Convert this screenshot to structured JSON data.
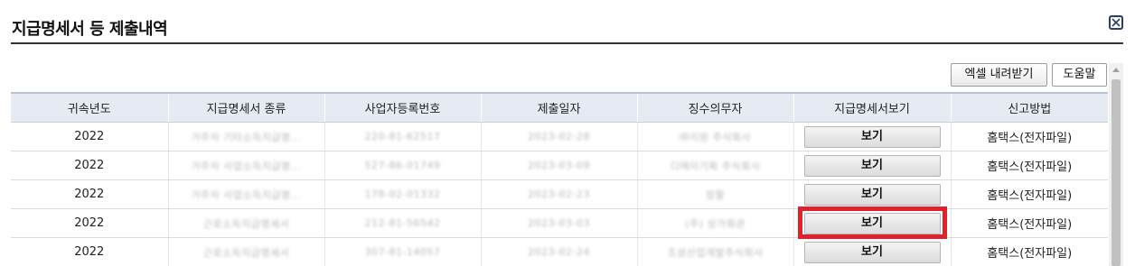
{
  "window": {
    "title": "지급명세서 등 제출내역",
    "close_icon": "close-icon"
  },
  "toolbar": {
    "excel_label": "엑셀 내려받기",
    "help_label": "도움말"
  },
  "table": {
    "columns": [
      "귀속년도",
      "지급명세서 종류",
      "사업자등록번호",
      "제출일자",
      "징수의무자",
      "지급명세서보기",
      "신고방법"
    ],
    "rows": [
      {
        "year": "2022",
        "type": "거주자 기타소득지급명...",
        "bizno": "220-81-62517",
        "date": "2023-02-28",
        "withholder": "㈜지원 주식회사",
        "view_label": "보기",
        "method": "홈택스(전자파일)"
      },
      {
        "year": "2022",
        "type": "거주자 사업소득지급명...",
        "bizno": "527-86-01749",
        "date": "2023-03-09",
        "withholder": "디에이기획 주식회사",
        "view_label": "보기",
        "method": "홈택스(전자파일)"
      },
      {
        "year": "2022",
        "type": "거주자 사업소득지급명...",
        "bizno": "178-02-01332",
        "date": "2023-02-23",
        "withholder": "정활",
        "view_label": "보기",
        "method": "홈택스(전자파일)"
      },
      {
        "year": "2022",
        "type": "근로소득지급명세서",
        "bizno": "212-81-56542",
        "date": "2023-03-03",
        "withholder": "(주) 상가회관",
        "view_label": "보기",
        "method": "홈택스(전자파일)"
      },
      {
        "year": "2022",
        "type": "근로소득지급명세서",
        "bizno": "307-81-14057",
        "date": "2023-02-24",
        "withholder": "조성산업개발주식회사",
        "view_label": "보기",
        "method": "홈택스(전자파일)"
      }
    ],
    "highlighted_row": 3
  },
  "colors": {
    "header_bg": "#e6ebf3",
    "highlight": "#e0202a"
  }
}
